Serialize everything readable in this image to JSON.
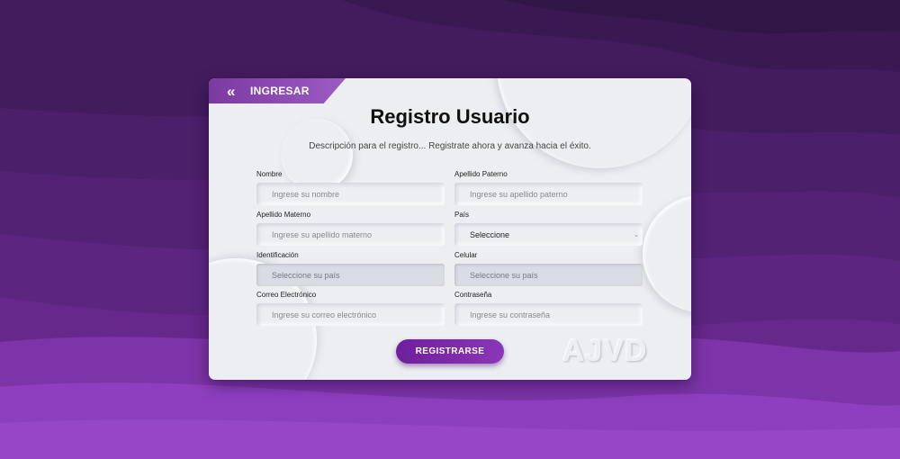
{
  "header": {
    "back_label": "INGRESAR",
    "back_icon": "double-chevron-left-icon"
  },
  "form": {
    "title": "Registro Usuario",
    "description": "Descripción para el registro... Registrate ahora y avanza hacia el éxito.",
    "fields": [
      {
        "label": "Nombre",
        "placeholder": "Ingrese su nombre"
      },
      {
        "label": "Apellido Paterno",
        "placeholder": "Ingrese su apellido paterno"
      },
      {
        "label": "Apellido Materno",
        "placeholder": "Ingrese su apellido materno"
      },
      {
        "label": "País",
        "value": "Seleccione"
      },
      {
        "label": "Identificación",
        "placeholder": "Seleccione su país"
      },
      {
        "label": "Celular",
        "placeholder": "Seleccione su país"
      },
      {
        "label": "Correo Electrónico",
        "placeholder": "Ingrese su correo electrónico"
      },
      {
        "label": "Contraseña",
        "placeholder": "Ingrese su contraseña"
      }
    ],
    "submit_label": "REGISTRARSE",
    "logo_text": "AJVD"
  },
  "colors": {
    "accent": "#7a2aa6",
    "card": "#eceef2",
    "background": "#4a1f66"
  }
}
